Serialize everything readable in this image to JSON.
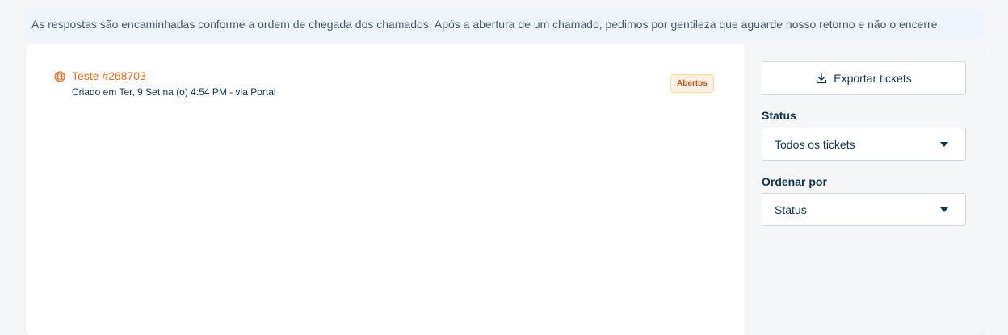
{
  "notice": {
    "text": "As respostas são encaminhadas conforme a ordem de chegada dos chamados. Após a abertura de um chamado, pedimos por gentileza que aguarde nosso retorno e não o encerre."
  },
  "tickets": [
    {
      "icon": "globe-icon",
      "title": "Teste #268703",
      "meta": "Criado em Ter, 9 Set na (o) 4:54 PM - via Portal",
      "status_badge": "Abertos"
    }
  ],
  "sidebar": {
    "export_label": "Exportar tickets",
    "export_icon": "download-icon",
    "status_label": "Status",
    "status_value": "Todos os tickets",
    "sort_label": "Ordenar por",
    "sort_value": "Status"
  },
  "colors": {
    "accent": "#e86f25",
    "text": "#12344d",
    "badge_bg": "#fef1e1",
    "badge_border": "#fdd7a8",
    "notice_bg": "#eef5fd"
  }
}
